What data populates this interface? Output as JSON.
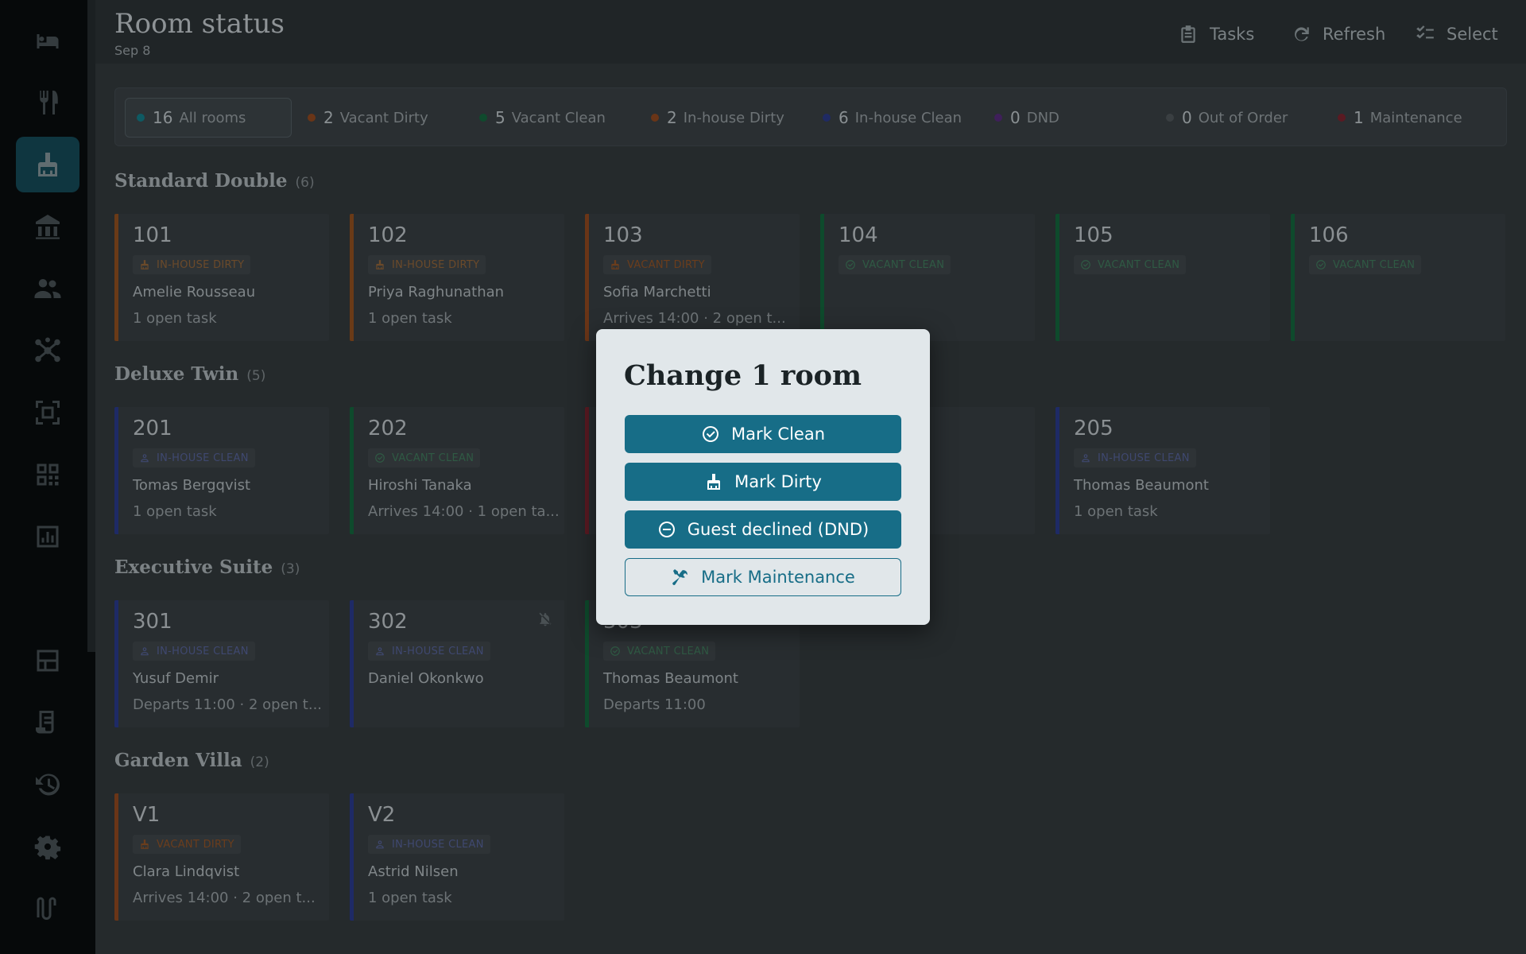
{
  "sidebar": {
    "items": [
      {
        "icon": "bed-icon",
        "active": false
      },
      {
        "icon": "restaurant-icon",
        "active": false
      },
      {
        "icon": "housekeeping-icon",
        "active": true
      },
      {
        "icon": "property-icon",
        "active": false
      },
      {
        "icon": "people-icon",
        "active": false
      },
      {
        "icon": "hub-icon",
        "active": false
      },
      {
        "icon": "frame-icon",
        "active": false
      },
      {
        "icon": "qr-code-icon",
        "active": false
      },
      {
        "icon": "report-icon",
        "active": false
      },
      {
        "icon": "night-audit-icon",
        "active": false
      },
      {
        "icon": "building-icon",
        "active": false
      },
      {
        "icon": "receipt-icon",
        "active": false
      },
      {
        "icon": "history-icon",
        "active": false
      },
      {
        "icon": "settings-icon",
        "active": false
      },
      {
        "icon": "logo-icon",
        "active": false
      }
    ]
  },
  "header": {
    "title": "Room status",
    "date": "Sep 8",
    "tasks_label": "Tasks",
    "refresh_label": "Refresh",
    "select_label": "Select"
  },
  "filters": [
    {
      "count": "16",
      "label": "All rooms",
      "color": "#0e5a63",
      "active": true
    },
    {
      "count": "2",
      "label": "Vacant Dirty",
      "color": "#6a3517",
      "active": false
    },
    {
      "count": "5",
      "label": "Vacant Clean",
      "color": "#0f4a2d",
      "active": false
    },
    {
      "count": "2",
      "label": "In-house Dirty",
      "color": "#6a3517",
      "active": false
    },
    {
      "count": "6",
      "label": "In-house Clean",
      "color": "#1f2a63",
      "active": false
    },
    {
      "count": "0",
      "label": "DND",
      "color": "#3f1f5a",
      "active": false
    },
    {
      "count": "0",
      "label": "Out of Order",
      "color": "#3a3f42",
      "active": false
    },
    {
      "count": "1",
      "label": "Maintenance",
      "color": "#5a1a22",
      "active": false
    }
  ],
  "status_colors": {
    "in_house_dirty": "#6a3a17",
    "vacant_dirty": "#6a3517",
    "vacant_clean": "#0e4a2c",
    "in_house_clean": "#1e2a66",
    "maintenance": "#5a1a22"
  },
  "sections": [
    {
      "title": "Standard Double",
      "count": "(6)",
      "rooms": [
        {
          "number": "101",
          "status": "IN-HOUSE DIRTY",
          "kind": "in_house_dirty",
          "guest": "Amelie Rousseau",
          "info": "1 open task"
        },
        {
          "number": "102",
          "status": "IN-HOUSE DIRTY",
          "kind": "in_house_dirty",
          "guest": "Priya Raghunathan",
          "info": "1 open task"
        },
        {
          "number": "103",
          "status": "VACANT DIRTY",
          "kind": "vacant_dirty",
          "guest": "Sofia Marchetti",
          "info": "Arrives 14:00 · 2 open t..."
        },
        {
          "number": "104",
          "status": "VACANT CLEAN",
          "kind": "vacant_clean",
          "guest": "",
          "info": ""
        },
        {
          "number": "105",
          "status": "VACANT CLEAN",
          "kind": "vacant_clean",
          "guest": "",
          "info": ""
        },
        {
          "number": "106",
          "status": "VACANT CLEAN",
          "kind": "vacant_clean",
          "guest": "",
          "info": ""
        }
      ]
    },
    {
      "title": "Deluxe Twin",
      "count": "(5)",
      "rooms": [
        {
          "number": "201",
          "status": "IN-HOUSE CLEAN",
          "kind": "in_house_clean",
          "guest": "Tomas Bergqvist",
          "info": "1 open task"
        },
        {
          "number": "202",
          "status": "VACANT CLEAN",
          "kind": "vacant_clean",
          "guest": "Hiroshi Tanaka",
          "info": "Arrives 14:00 · 1 open ta..."
        },
        {
          "number": "",
          "status": "",
          "kind": "maintenance",
          "guest": "",
          "info": ""
        },
        {
          "number": "",
          "status": "EAN",
          "kind": "vacant_clean",
          "guest": "",
          "info": ""
        },
        {
          "number": "205",
          "status": "IN-HOUSE CLEAN",
          "kind": "in_house_clean",
          "guest": "Thomas Beaumont",
          "info": "1 open task"
        }
      ]
    },
    {
      "title": "Executive Suite",
      "count": "(3)",
      "rooms": [
        {
          "number": "301",
          "status": "IN-HOUSE CLEAN",
          "kind": "in_house_clean",
          "guest": "Yusuf Demir",
          "info": "Departs 11:00 · 2 open t..."
        },
        {
          "number": "302",
          "status": "IN-HOUSE CLEAN",
          "kind": "in_house_clean",
          "guest": "Daniel Okonkwo",
          "info": "",
          "bell": true
        },
        {
          "number": "303",
          "status": "VACANT CLEAN",
          "kind": "vacant_clean",
          "guest": "Thomas Beaumont",
          "info": "Departs 11:00"
        }
      ]
    },
    {
      "title": "Garden Villa",
      "count": "(2)",
      "rooms": [
        {
          "number": "V1",
          "status": "VACANT DIRTY",
          "kind": "vacant_dirty",
          "guest": "Clara Lindqvist",
          "info": "Arrives 14:00 · 2 open t..."
        },
        {
          "number": "V2",
          "status": "IN-HOUSE CLEAN",
          "kind": "in_house_clean",
          "guest": "Astrid Nilsen",
          "info": "1 open task"
        }
      ]
    }
  ],
  "modal": {
    "title": "Change 1 room",
    "mark_clean": "Mark Clean",
    "mark_dirty": "Mark Dirty",
    "dnd": "Guest declined (DND)",
    "maintenance": "Mark Maintenance",
    "button_color": "#176d87"
  }
}
